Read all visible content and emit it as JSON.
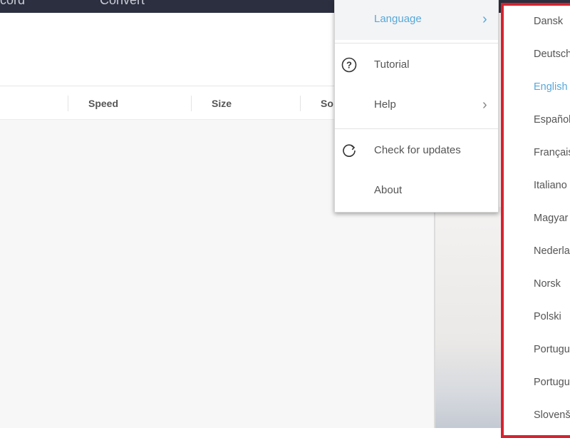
{
  "topbar": {
    "nav_left": "ocord",
    "nav_right": "Convert"
  },
  "columns": {
    "speed": "Speed",
    "size": "Size",
    "source": "So"
  },
  "settings_menu": {
    "items": [
      {
        "label": "Language",
        "icon": "none",
        "submenu": true,
        "active": true
      },
      {
        "label": "Tutorial",
        "icon": "question-circle-icon",
        "submenu": false
      },
      {
        "label": "Help",
        "icon": "none",
        "submenu": true
      },
      {
        "label": "Check for updates",
        "icon": "refresh-icon",
        "submenu": false
      },
      {
        "label": "About",
        "icon": "none",
        "submenu": false
      }
    ]
  },
  "language_menu": {
    "highlight_color": "#d7222f",
    "selected": "English",
    "items": [
      "Dansk",
      "Deutsch",
      "English",
      "Español",
      "Français",
      "Italiano",
      "Magyar",
      "Nederlands",
      "Norsk",
      "Polski",
      "Português",
      "Português",
      "Slovenščina"
    ]
  },
  "colors": {
    "accent": "#58a8d8",
    "topbar": "#2b2f3f",
    "highlight_border": "#d7222f"
  }
}
